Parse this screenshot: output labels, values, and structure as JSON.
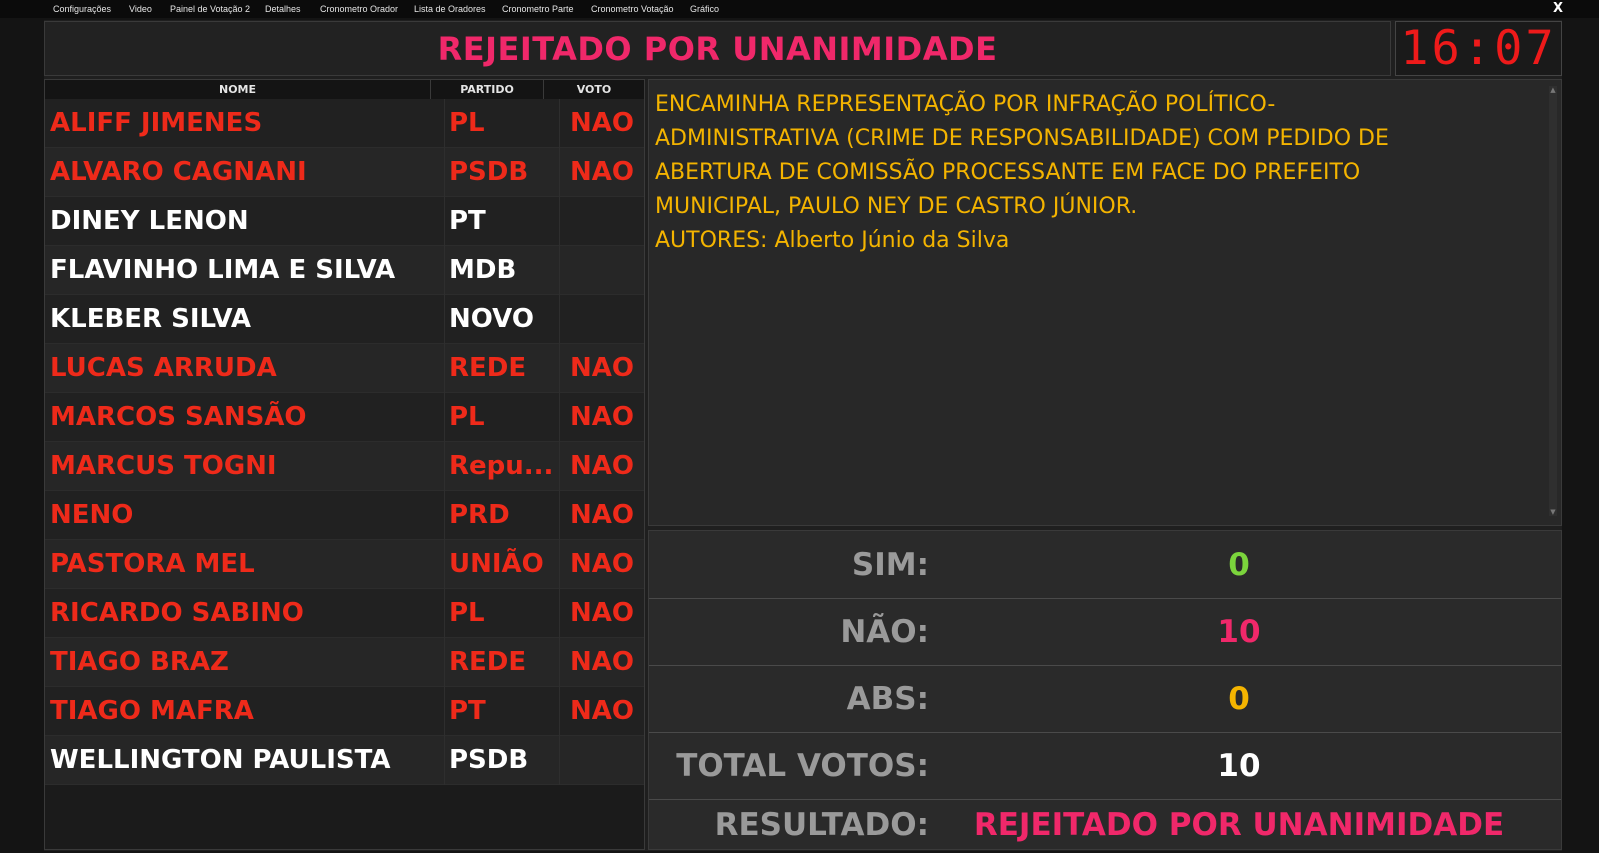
{
  "menu": {
    "items": [
      "Configurações",
      "Video",
      "Painel de Votação 2",
      "Detalhes",
      "Cronometro Orador",
      "Lista de Oradores",
      "Cronometro Parte",
      "Cronometro Votação",
      "Gráfico"
    ],
    "close_label": "X"
  },
  "header": {
    "title": "REJEITADO POR UNANIMIDADE",
    "clock": "16:07"
  },
  "table": {
    "columns": {
      "name": "NOME",
      "party": "PARTIDO",
      "vote": "VOTO"
    },
    "rows": [
      {
        "name": "ALIFF JIMENES",
        "party": "PL",
        "vote": "NAO",
        "voted": true
      },
      {
        "name": "ALVARO CAGNANI",
        "party": "PSDB",
        "vote": "NAO",
        "voted": true
      },
      {
        "name": "DINEY LENON",
        "party": "PT",
        "vote": "",
        "voted": false
      },
      {
        "name": "FLAVINHO LIMA E SILVA",
        "party": "MDB",
        "vote": "",
        "voted": false
      },
      {
        "name": "KLEBER SILVA",
        "party": "NOVO",
        "vote": "",
        "voted": false
      },
      {
        "name": "LUCAS ARRUDA",
        "party": "REDE",
        "vote": "NAO",
        "voted": true
      },
      {
        "name": "MARCOS SANSÃO",
        "party": "PL",
        "vote": "NAO",
        "voted": true
      },
      {
        "name": "MARCUS TOGNI",
        "party": "Repu...",
        "vote": "NAO",
        "voted": true
      },
      {
        "name": "NENO",
        "party": "PRD",
        "vote": "NAO",
        "voted": true
      },
      {
        "name": "PASTORA MEL",
        "party": "UNIÃO",
        "vote": "NAO",
        "voted": true
      },
      {
        "name": "RICARDO SABINO",
        "party": "PL",
        "vote": "NAO",
        "voted": true
      },
      {
        "name": "TIAGO BRAZ",
        "party": "REDE",
        "vote": "NAO",
        "voted": true
      },
      {
        "name": "TIAGO MAFRA",
        "party": "PT",
        "vote": "NAO",
        "voted": true
      },
      {
        "name": "WELLINGTON PAULISTA",
        "party": "PSDB",
        "vote": "",
        "voted": false
      }
    ]
  },
  "description": {
    "text_lines": [
      "ENCAMINHA REPRESENTAÇÃO POR INFRAÇÃO POLÍTICO-",
      "ADMINISTRATIVA (CRIME DE RESPONSABILIDADE) COM PEDIDO DE",
      "ABERTURA DE COMISSÃO PROCESSANTE EM FACE DO PREFEITO",
      "MUNICIPAL, PAULO NEY DE CASTRO JÚNIOR."
    ],
    "authors": "AUTORES: Alberto Júnio da Silva"
  },
  "results": {
    "rows": [
      {
        "label": "SIM:",
        "value": "0",
        "color": "#7bd43c"
      },
      {
        "label": "NÃO:",
        "value": "10",
        "color": "#f0286a"
      },
      {
        "label": "ABS:",
        "value": "0",
        "color": "#f4b400"
      },
      {
        "label": "TOTAL VOTOS:",
        "value": "10",
        "color": "#ffffff"
      },
      {
        "label": "RESULTADO:",
        "value": "REJEITADO POR UNANIMIDADE",
        "color": "#f0286a"
      }
    ]
  },
  "colors": {
    "voted": "#ee2a1a",
    "not_voted": "#ffffff",
    "title": "#f0286a",
    "description": "#f4b400",
    "clock": "#ee1a1a"
  }
}
